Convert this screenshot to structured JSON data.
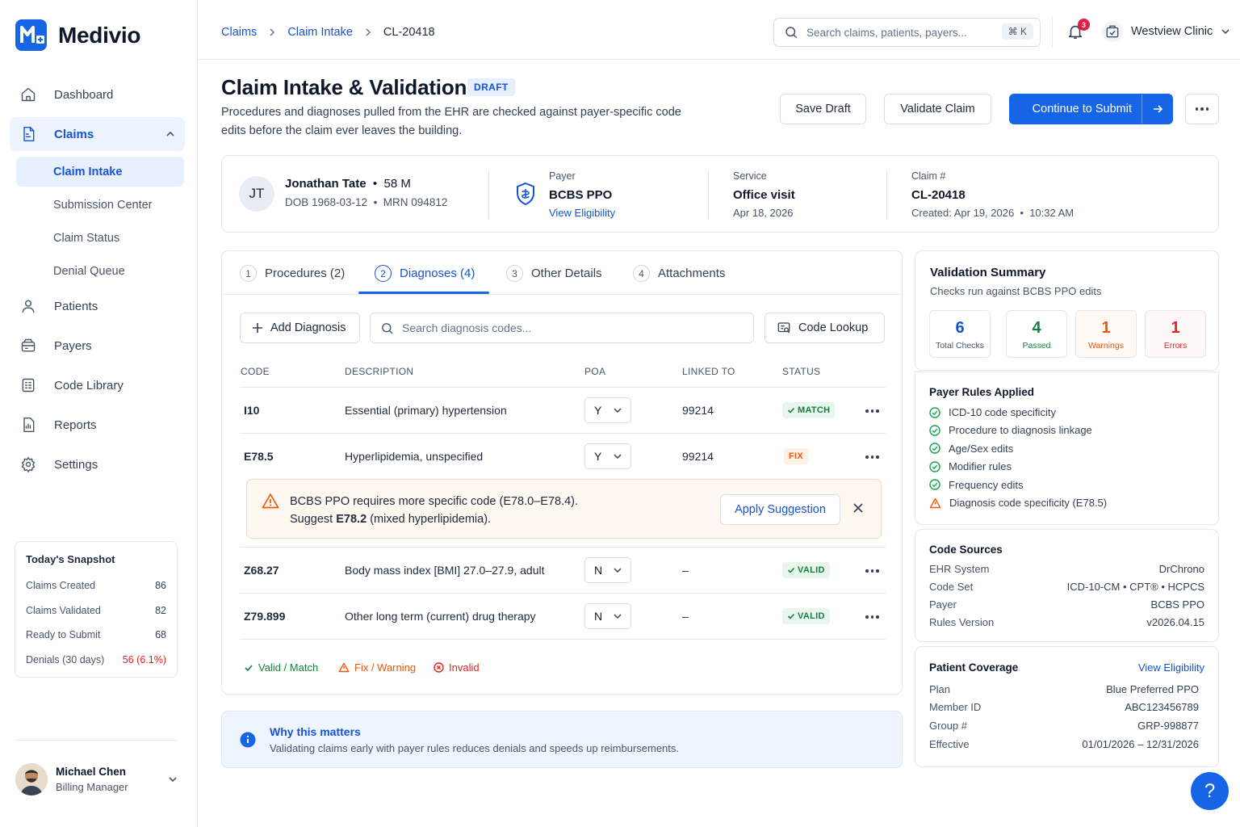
{
  "app": {
    "name": "Medivio"
  },
  "nav": {
    "dashboard": "Dashboard",
    "claims": "Claims",
    "claim_intake": "Claim Intake",
    "submission_center": "Submission Center",
    "claim_status": "Claim Status",
    "denial_queue": "Denial Queue",
    "patients": "Patients",
    "payers": "Payers",
    "code_library": "Code Library",
    "reports": "Reports",
    "settings": "Settings"
  },
  "snapshot": {
    "title": "Today's Snapshot",
    "rows": [
      {
        "label": "Claims Created",
        "value": "86"
      },
      {
        "label": "Claims Validated",
        "value": "82"
      },
      {
        "label": "Ready to Submit",
        "value": "68"
      },
      {
        "label": "Denials (30 days)",
        "value": "56 (6.1%)"
      }
    ]
  },
  "user": {
    "name": "Michael Chen",
    "role": "Billing Manager"
  },
  "breadcrumb": [
    "Claims",
    "Claim Intake",
    "CL-20418"
  ],
  "search": {
    "placeholder": "Search claims, patients, payers...",
    "shortcut": "⌘  K"
  },
  "notifications": {
    "count": "3"
  },
  "clinic": {
    "name": "Westview Clinic"
  },
  "header": {
    "title": "Claim Intake & Validation",
    "status": "DRAFT",
    "description": "Procedures and diagnoses pulled from the EHR are checked against payer-specific code edits before the claim ever leaves the building.",
    "save_draft": "Save Draft",
    "validate": "Validate Claim",
    "continue": "Continue to Submit"
  },
  "patient": {
    "initials": "JT",
    "name": "Jonathan Tate",
    "age_sex": "58 M",
    "dob": "DOB 1968-03-12",
    "mrn": "MRN 094812",
    "payer_label": "Payer",
    "payer": "BCBS PPO",
    "eligibility_link": "View Eligibility",
    "service_label": "Service",
    "service": "Office visit",
    "service_date": "Apr 18, 2026",
    "claim_label": "Claim #",
    "claim_id": "CL-20418",
    "created": "Created: Apr 19, 2026",
    "created_time": "10:32 AM"
  },
  "tabs": [
    {
      "num": "1",
      "label": "Procedures (2)"
    },
    {
      "num": "2",
      "label": "Diagnoses (4)"
    },
    {
      "num": "3",
      "label": "Other Details"
    },
    {
      "num": "4",
      "label": "Attachments"
    }
  ],
  "toolbar": {
    "add": "Add Diagnosis",
    "search_placeholder": "Search diagnosis codes...",
    "lookup": "Code Lookup"
  },
  "table": {
    "headers": [
      "CODE",
      "DESCRIPTION",
      "POA",
      "LINKED TO",
      "STATUS"
    ],
    "rows": [
      {
        "code": "I10",
        "desc": "Essential (primary) hypertension",
        "poa": "Y",
        "linked": "99214",
        "status": "MATCH"
      },
      {
        "code": "E78.5",
        "desc": "Hyperlipidemia, unspecified",
        "poa": "Y",
        "linked": "99214",
        "status": "FIX"
      },
      {
        "code": "Z68.27",
        "desc": "Body mass index [BMI] 27.0–27.9, adult",
        "poa": "N",
        "linked": "–",
        "status": "VALID"
      },
      {
        "code": "Z79.899",
        "desc": "Other long term (current) drug therapy",
        "poa": "N",
        "linked": "–",
        "status": "VALID"
      }
    ]
  },
  "alert": {
    "line1": "BCBS PPO requires more specific code (E78.0–E78.4).",
    "line2_pre": "Suggest",
    "line2_code": "E78.2",
    "line2_post": "(mixed hyperlipidemia).",
    "apply": "Apply Suggestion"
  },
  "legend": {
    "valid": "Valid / Match",
    "fix": "Fix / Warning",
    "invalid": "Invalid"
  },
  "why": {
    "title": "Why this matters",
    "desc": "Validating claims early with payer rules reduces denials and speeds up reimbursements."
  },
  "validation": {
    "title": "Validation Summary",
    "sub": "Checks run against BCBS PPO edits",
    "stats": [
      {
        "value": "6",
        "label": "Total Checks",
        "color": "#1553d6"
      },
      {
        "value": "4",
        "label": "Passed",
        "color": "#15803d"
      },
      {
        "value": "1",
        "label": "Warnings",
        "color": "#ea580c"
      },
      {
        "value": "1",
        "label": "Errors",
        "color": "#dc2626"
      }
    ]
  },
  "rules": {
    "title": "Payer Rules Applied",
    "items": [
      {
        "label": "ICD-10 code specificity",
        "state": "pass"
      },
      {
        "label": "Procedure to diagnosis linkage",
        "state": "pass"
      },
      {
        "label": "Age/Sex edits",
        "state": "pass"
      },
      {
        "label": "Modifier rules",
        "state": "pass"
      },
      {
        "label": "Frequency edits",
        "state": "pass"
      },
      {
        "label": "Diagnosis code specificity (E78.5)",
        "state": "warn"
      }
    ]
  },
  "sources": {
    "title": "Code Sources",
    "rows": [
      {
        "label": "EHR System",
        "value": "DrChrono"
      },
      {
        "label": "Code Set",
        "value": "ICD-10-CM  •  CPT®  •  HCPCS"
      },
      {
        "label": "Payer",
        "value": "BCBS PPO"
      },
      {
        "label": "Rules Version",
        "value": "v2026.04.15"
      }
    ]
  },
  "coverage": {
    "title": "Patient Coverage",
    "link": "View Eligibility",
    "rows": [
      {
        "label": "Plan",
        "value": "Blue Preferred PPO"
      },
      {
        "label": "Member ID",
        "value": "ABC123456789"
      },
      {
        "label": "Group #",
        "value": "GRP-998877"
      },
      {
        "label": "Effective",
        "value": "01/01/2026 – 12/31/2026"
      }
    ]
  },
  "help": {
    "label": "?"
  }
}
